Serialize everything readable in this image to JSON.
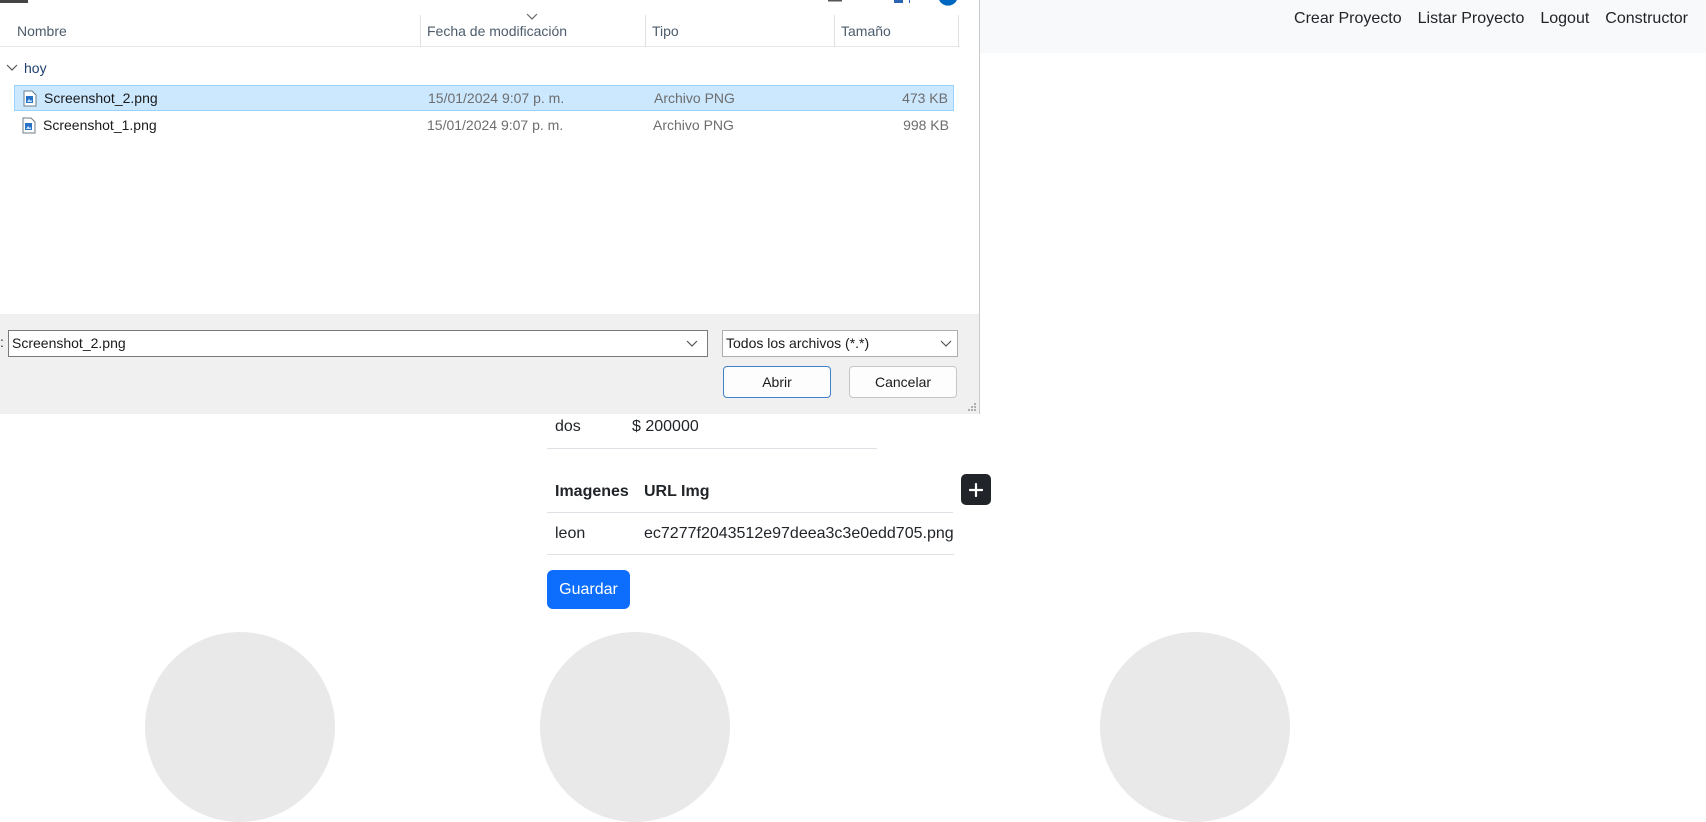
{
  "navbar": {
    "links": [
      "Crear Proyecto",
      "Listar Proyecto",
      "Logout",
      "Constructor"
    ]
  },
  "price_row": {
    "name": "dos",
    "amount": "$ 200000"
  },
  "images_table": {
    "headers": [
      "Imagenes",
      "URL Img"
    ],
    "rows": [
      {
        "name": "leon",
        "url": "ec7277f2043512e97deea3c3e0edd705.png"
      }
    ],
    "add_icon": "plus-icon"
  },
  "save_label": "Guardar",
  "dialog": {
    "columns": [
      "Nombre",
      "Fecha de modificación",
      "Tipo",
      "Tamaño"
    ],
    "group": "hoy",
    "files": [
      {
        "name": "Screenshot_2.png",
        "date": "15/01/2024 9:07 p. m.",
        "type": "Archivo PNG",
        "size": "473 KB"
      },
      {
        "name": "Screenshot_1.png",
        "date": "15/01/2024 9:07 p. m.",
        "type": "Archivo PNG",
        "size": "998 KB"
      }
    ],
    "filename_colon": ":",
    "filename_value": "Screenshot_2.png",
    "filter_value": "Todos los archivos (*.*)",
    "open_label": "Abrir",
    "cancel_label": "Cancelar"
  },
  "colors": {
    "primary": "#0d6efd",
    "selection": "#cce8ff",
    "dark_button": "#212529"
  }
}
